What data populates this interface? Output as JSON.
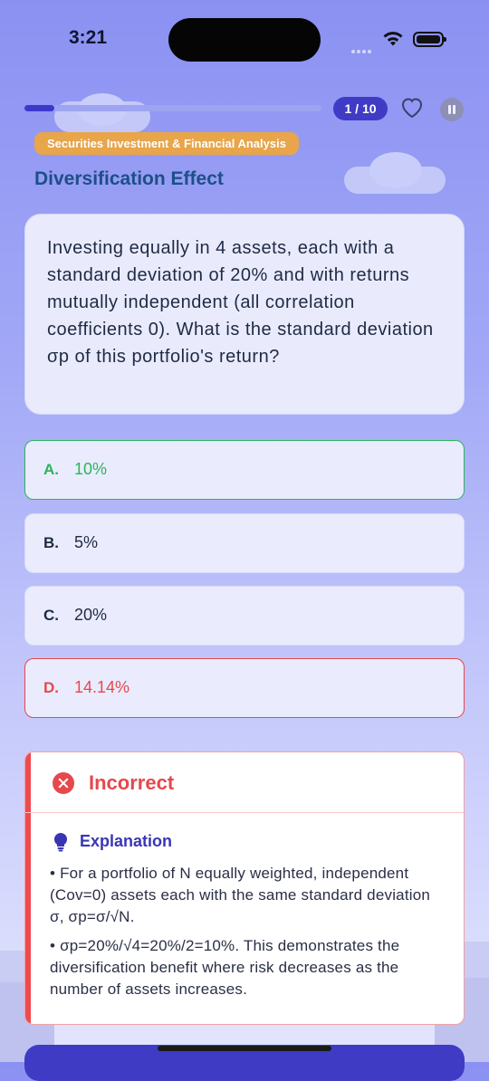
{
  "status_bar": {
    "time": "3:21"
  },
  "progress": {
    "label": "1 / 10",
    "fraction": 0.1
  },
  "category": "Securities Investment & Financial Analysis",
  "topic": "Diversification Effect",
  "question": "Investing equally in 4 assets, each with a standard deviation of 20% and with returns mutually independent (all correlation coefficients 0). What is the standard deviation σp of this portfolio's return?",
  "options": [
    {
      "letter": "A.",
      "value": "10%",
      "state": "correct"
    },
    {
      "letter": "B.",
      "value": "5%",
      "state": "neutral"
    },
    {
      "letter": "C.",
      "value": "20%",
      "state": "neutral"
    },
    {
      "letter": "D.",
      "value": "14.14%",
      "state": "wrong"
    }
  ],
  "feedback": {
    "result": "Incorrect",
    "explanation_title": "Explanation",
    "explanation_points": [
      "• For a portfolio of N equally weighted, independent (Cov=0) assets each with the same standard deviation σ, σp=σ/√N.",
      "• σp=20%/√4=20%/2=10%. This demonstrates the diversification benefit where risk decreases as the number of assets increases."
    ]
  },
  "icons": {
    "heart": "heart-outline-icon",
    "pause": "pause-icon",
    "result": "x-circle-icon",
    "explanation": "lightbulb-icon"
  },
  "colors": {
    "accent": "#3f3bc5",
    "correct": "#2bb45b",
    "wrong": "#e5484d",
    "category_badge": "#e8a54a",
    "topic": "#1d4f88"
  }
}
